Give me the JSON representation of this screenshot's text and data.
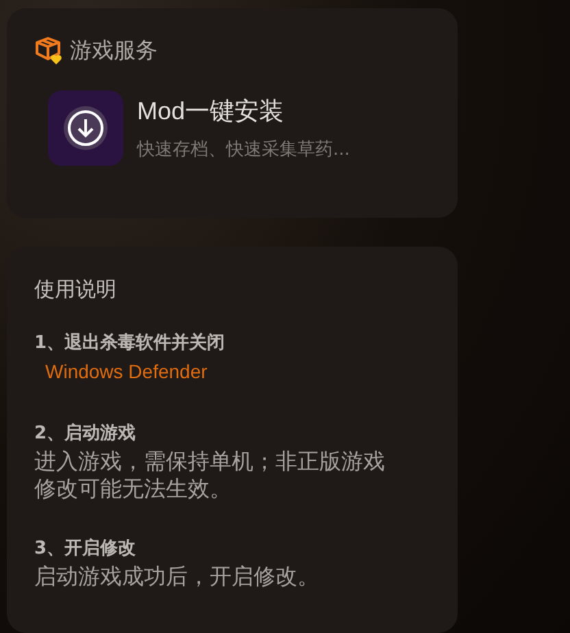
{
  "service_panel": {
    "title": "游戏服务",
    "items": [
      {
        "title": "Mod一键安装",
        "subtitle": "快速存档、快速采集草药..."
      }
    ]
  },
  "instructions": {
    "title": "使用说明",
    "steps": [
      {
        "title": "1、退出杀毒软件并关闭",
        "link": "Windows Defender"
      },
      {
        "title": "2、启动游戏",
        "body": "进入游戏，需保持单机；非正版游戏修改可能无法生效。"
      },
      {
        "title": "3、开启修改",
        "body": "启动游戏成功后，开启修改。"
      }
    ]
  }
}
